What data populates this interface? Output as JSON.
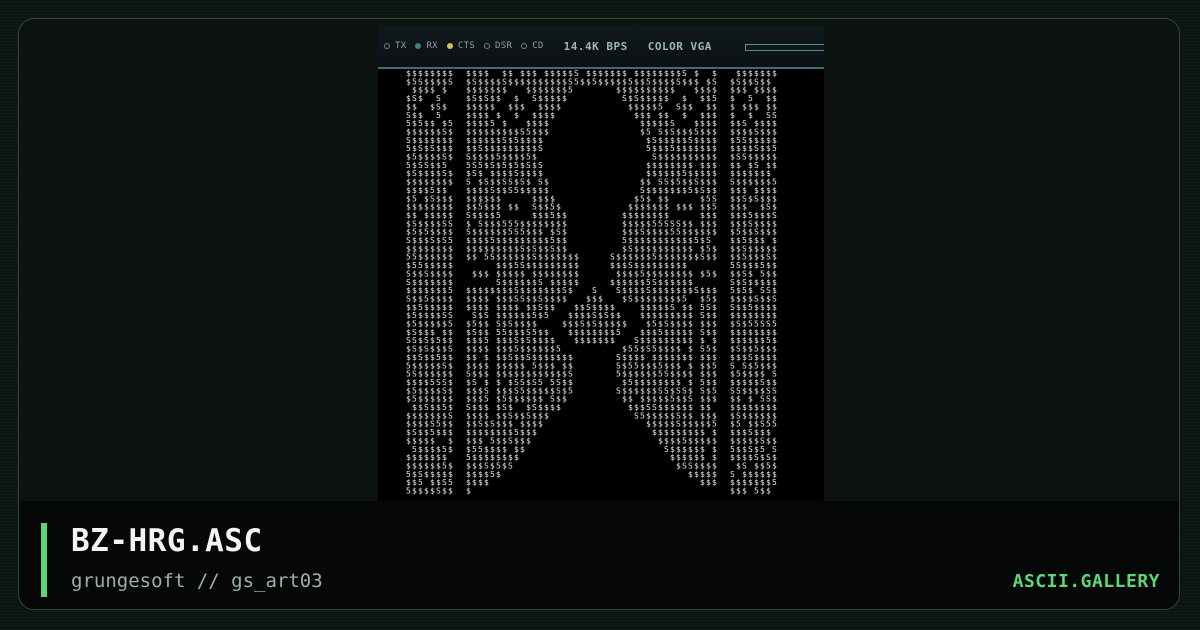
{
  "status_bar": {
    "indicators": [
      {
        "label": "TX",
        "state": "off",
        "color": "#6f8388"
      },
      {
        "label": "RX",
        "state": "on",
        "color": "#3f7f83"
      },
      {
        "label": "CTS",
        "state": "on",
        "color": "#d7c25a"
      },
      {
        "label": "DSR",
        "state": "off",
        "color": "#6f8388"
      },
      {
        "label": "CD",
        "state": "off",
        "color": "#6f8388"
      }
    ],
    "speed": "14.4K BPS",
    "mode": "COLOR VGA",
    "meter_level": 0.0
  },
  "artwork": {
    "filename": "BZ-HRG.ASC",
    "glyphs": "$S5",
    "foreground": "#e6e6e6",
    "background": "#000000"
  },
  "footer": {
    "title": "BZ-HRG.ASC",
    "subtitle": "grungesoft // gs_art03",
    "brand": "ASCII.GALLERY"
  },
  "colors": {
    "accent": "#5dd67a",
    "page_background": "#0d1512",
    "frame_border": "#2c4a39"
  }
}
